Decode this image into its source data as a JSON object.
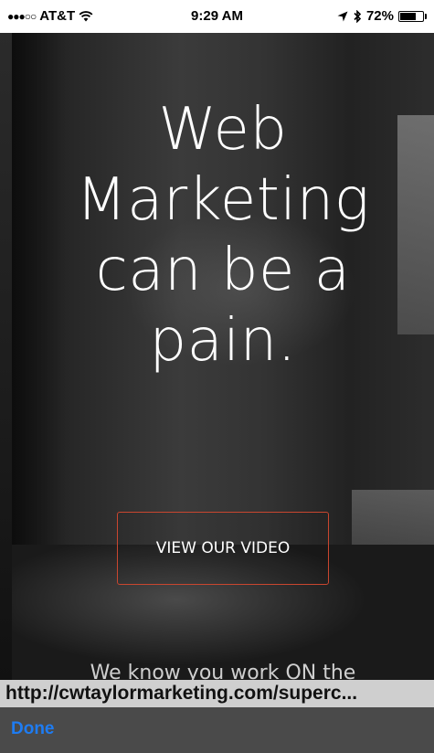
{
  "status_bar": {
    "carrier": "AT&T",
    "time": "9:29 AM",
    "battery_percent": "72%",
    "battery_level": 0.72,
    "icons": [
      "signal-dots-icon",
      "wifi-icon",
      "location-arrow-icon",
      "bluetooth-icon",
      "battery-icon"
    ]
  },
  "hero": {
    "headline_lines": [
      "Web",
      "Marketing",
      "can be a",
      "pain."
    ],
    "cta_label": "VIEW OUR VIDEO",
    "cta_border_color": "#c9462f",
    "subtext": "We know you work ON the"
  },
  "browser": {
    "url": "http://cwtaylormarketing.com/superc...",
    "done_label": "Done",
    "accent": "#1e7cf2"
  }
}
